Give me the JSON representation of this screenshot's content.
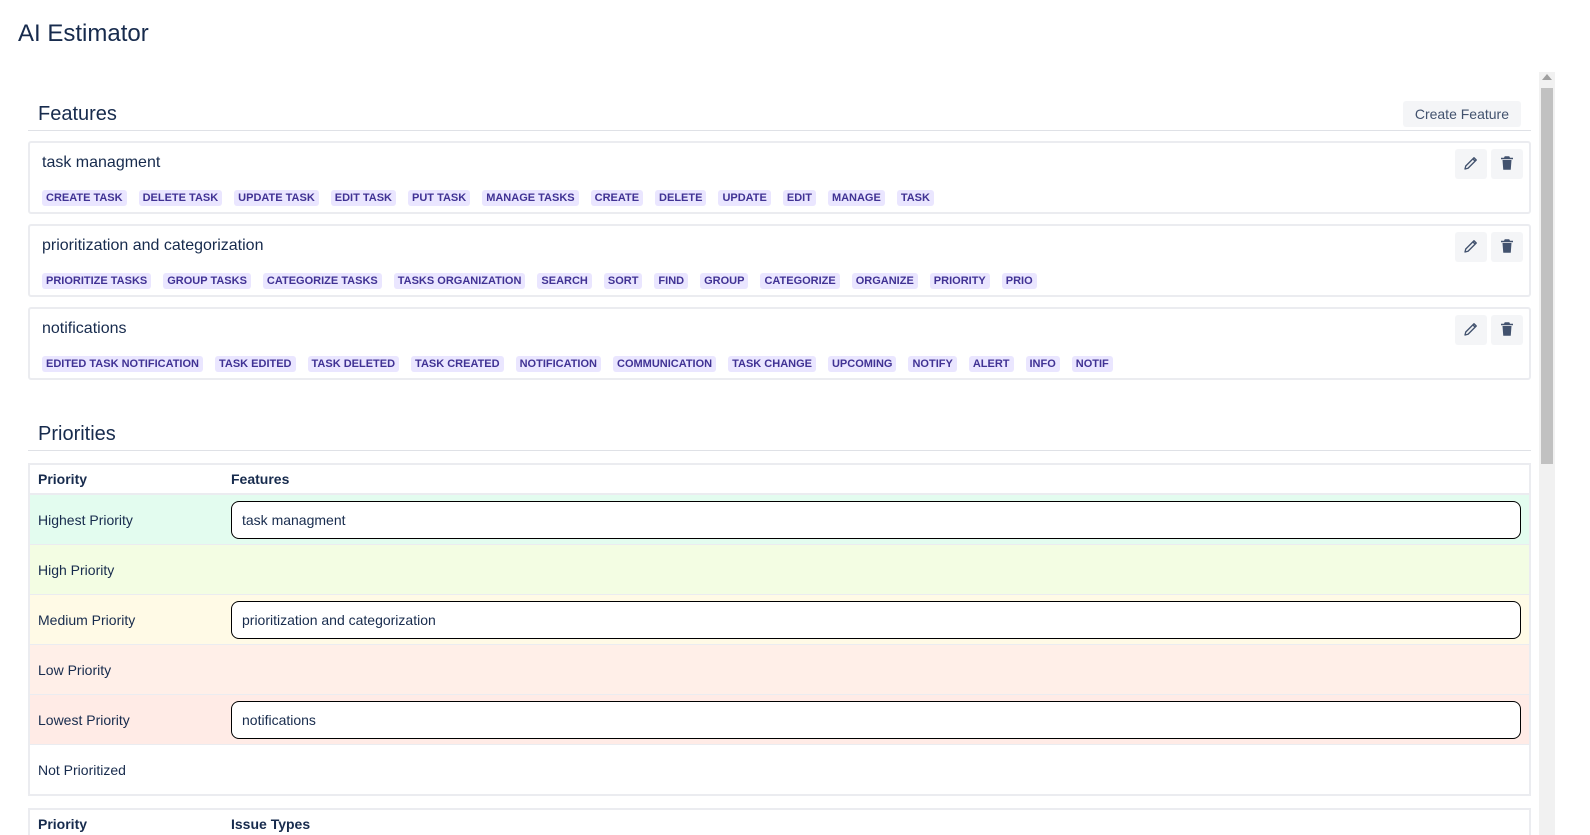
{
  "app": {
    "title": "AI Estimator"
  },
  "features_section": {
    "title": "Features",
    "create_label": "Create Feature",
    "features": [
      {
        "name": "task managment",
        "tags": [
          "CREATE TASK",
          "DELETE TASK",
          "UPDATE TASK",
          "EDIT TASK",
          "PUT TASK",
          "MANAGE TASKS",
          "CREATE",
          "DELETE",
          "UPDATE",
          "EDIT",
          "MANAGE",
          "TASK"
        ]
      },
      {
        "name": "prioritization and categorization",
        "tags": [
          "PRIORITIZE TASKS",
          "GROUP TASKS",
          "CATEGORIZE TASKS",
          "TASKS ORGANIZATION",
          "SEARCH",
          "SORT",
          "FIND",
          "GROUP",
          "CATEGORIZE",
          "ORGANIZE",
          "PRIORITY",
          "PRIO"
        ]
      },
      {
        "name": "notifications",
        "tags": [
          "EDITED TASK NOTIFICATION",
          "TASK EDITED",
          "TASK DELETED",
          "TASK CREATED",
          "NOTIFICATION",
          "COMMUNICATION",
          "TASK CHANGE",
          "UPCOMING",
          "NOTIFY",
          "ALERT",
          "INFO",
          "NOTIF"
        ]
      }
    ]
  },
  "priorities_section": {
    "title": "Priorities",
    "col_priority": "Priority",
    "col_features": "Features",
    "rows": [
      {
        "label": "Highest Priority",
        "feature": "task managment",
        "color": "#e3fcef"
      },
      {
        "label": "High Priority",
        "feature": "",
        "color": "#f3fde3"
      },
      {
        "label": "Medium Priority",
        "feature": "prioritization and categorization",
        "color": "#fffae6"
      },
      {
        "label": "Low Priority",
        "feature": "",
        "color": "#ffefe8"
      },
      {
        "label": "Lowest Priority",
        "feature": "notifications",
        "color": "#ffebe6"
      },
      {
        "label": "Not Prioritized",
        "feature": "",
        "color": "#ffffff"
      }
    ]
  },
  "issue_types_table": {
    "col_priority": "Priority",
    "col_issue_types": "Issue Types"
  },
  "colors": {
    "tag_bg": "#eae6ff",
    "tag_text": "#403294",
    "text": "#172b4d"
  }
}
